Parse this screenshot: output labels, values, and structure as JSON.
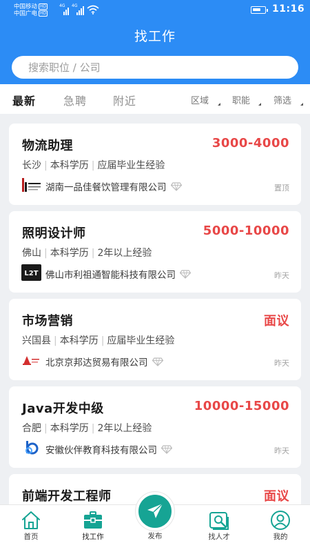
{
  "status_bar": {
    "carrier1": "中国移动",
    "carrier2": "中国广电",
    "hd_badge": "HD",
    "network_label": "4G",
    "battery_level": 0.7,
    "time": "11:16"
  },
  "header": {
    "title": "找工作",
    "search_placeholder": "搜索职位 / 公司"
  },
  "filter_tabs": [
    {
      "label": "最新",
      "active": true
    },
    {
      "label": "急聘",
      "active": false
    },
    {
      "label": "附近",
      "active": false
    }
  ],
  "filter_dropdowns": [
    "区域",
    "职能",
    "筛选"
  ],
  "jobs": [
    {
      "title": "物流助理",
      "salary": "3000-4000",
      "location": "长沙",
      "education": "本科学历",
      "experience": "应届毕业生经验",
      "company": "湖南一品佳餐饮管理有限公司",
      "meta": "置顶"
    },
    {
      "title": "照明设计师",
      "salary": "5000-10000",
      "location": "佛山",
      "education": "本科学历",
      "experience": "2年以上经验",
      "company": "佛山市利祖通智能科技有限公司",
      "meta": "昨天",
      "logo_text": "L2T"
    },
    {
      "title": "市场营销",
      "salary": "面议",
      "location": "兴国县",
      "education": "本科学历",
      "experience": "应届毕业生经验",
      "company": "北京京邦达贸易有限公司",
      "meta": "昨天"
    },
    {
      "title": "Java开发中级",
      "salary": "10000-15000",
      "location": "合肥",
      "education": "本科学历",
      "experience": "2年以上经验",
      "company": "安徽伙伴教育科技有限公司",
      "meta": "昨天"
    },
    {
      "title": "前端开发工程师",
      "salary": "面议"
    }
  ],
  "bottom_nav": [
    {
      "label": "首页",
      "icon": "home-icon"
    },
    {
      "label": "找工作",
      "icon": "briefcase-icon",
      "active": true
    },
    {
      "label": "发布",
      "icon": "send-icon"
    },
    {
      "label": "找人才",
      "icon": "find-talent-icon"
    },
    {
      "label": "我的",
      "icon": "profile-icon"
    }
  ],
  "colors": {
    "primary": "#2c8cf5",
    "salary": "#e84747",
    "publish": "#16a494",
    "active_nav": "#16a494"
  }
}
